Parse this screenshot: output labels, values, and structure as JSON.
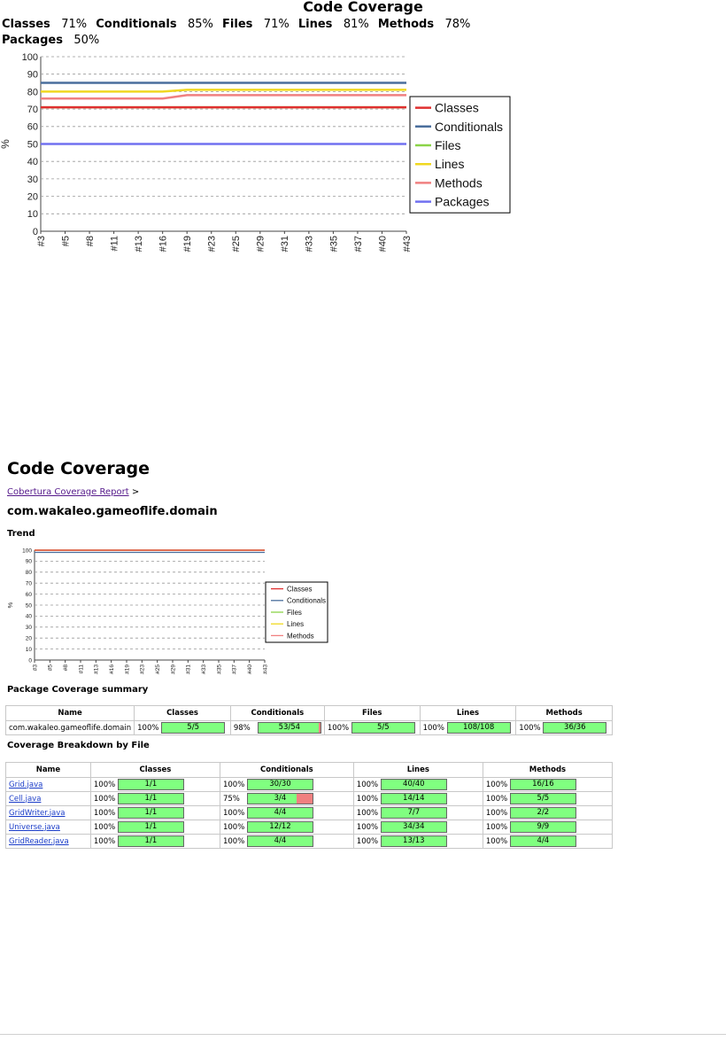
{
  "top": {
    "title": "Code Coverage",
    "summary_row1": [
      {
        "k": "Classes",
        "v": "71%"
      },
      {
        "k": "Conditionals",
        "v": "85%"
      },
      {
        "k": "Files",
        "v": "71%"
      },
      {
        "k": "Lines",
        "v": "81%"
      },
      {
        "k": "Methods",
        "v": "78%"
      }
    ],
    "summary_row2": [
      {
        "k": "Packages",
        "v": "50%"
      }
    ]
  },
  "section": {
    "heading": "Code Coverage",
    "breadcrumb_link": "Cobertura Coverage Report",
    "breadcrumb_sep": ">",
    "package_title": "com.wakaleo.gameoflife.domain",
    "trend_heading": "Trend",
    "package_summary_heading": "Package Coverage summary",
    "breakdown_heading": "Coverage Breakdown by File"
  },
  "chart_data": [
    {
      "type": "line",
      "ylabel": "%",
      "ylim": [
        0,
        100
      ],
      "yticks": [
        0,
        10,
        20,
        30,
        40,
        50,
        60,
        70,
        80,
        90,
        100
      ],
      "categories": [
        "#3",
        "#5",
        "#8",
        "#11",
        "#13",
        "#16",
        "#19",
        "#23",
        "#25",
        "#29",
        "#31",
        "#33",
        "#35",
        "#37",
        "#40",
        "#43"
      ],
      "grid": true,
      "legend_position": "right",
      "series": [
        {
          "name": "Classes",
          "color": "#e03030",
          "values": [
            71,
            71,
            71,
            71,
            71,
            71,
            71,
            71,
            71,
            71,
            71,
            71,
            71,
            71,
            71,
            71
          ]
        },
        {
          "name": "Conditionals",
          "color": "#4a6e9c",
          "values": [
            85,
            85,
            85,
            85,
            85,
            85,
            85,
            85,
            85,
            85,
            85,
            85,
            85,
            85,
            85,
            85
          ]
        },
        {
          "name": "Files",
          "color": "#8bd448",
          "values": [
            71,
            71,
            71,
            71,
            71,
            71,
            71,
            71,
            71,
            71,
            71,
            71,
            71,
            71,
            71,
            71
          ]
        },
        {
          "name": "Lines",
          "color": "#f0d820",
          "values": [
            80,
            80,
            80,
            80,
            80,
            80,
            81,
            81,
            81,
            81,
            81,
            81,
            81,
            81,
            81,
            81
          ]
        },
        {
          "name": "Methods",
          "color": "#f08080",
          "values": [
            76,
            76,
            76,
            76,
            76,
            76,
            78,
            78,
            78,
            78,
            78,
            78,
            78,
            78,
            78,
            78
          ]
        },
        {
          "name": "Packages",
          "color": "#7070f0",
          "values": [
            50,
            50,
            50,
            50,
            50,
            50,
            50,
            50,
            50,
            50,
            50,
            50,
            50,
            50,
            50,
            50
          ]
        }
      ]
    },
    {
      "type": "line",
      "ylabel": "%",
      "ylim": [
        0,
        100
      ],
      "yticks": [
        0,
        10,
        20,
        30,
        40,
        50,
        60,
        70,
        80,
        90,
        100
      ],
      "categories": [
        "#3",
        "#5",
        "#8",
        "#11",
        "#13",
        "#16",
        "#19",
        "#23",
        "#25",
        "#29",
        "#31",
        "#33",
        "#35",
        "#37",
        "#40",
        "#43"
      ],
      "grid": true,
      "legend_position": "right",
      "series": [
        {
          "name": "Classes",
          "color": "#e03030",
          "values": [
            100,
            100,
            100,
            100,
            100,
            100,
            100,
            100,
            100,
            100,
            100,
            100,
            100,
            100,
            100,
            100
          ]
        },
        {
          "name": "Conditionals",
          "color": "#4a6e9c",
          "values": [
            98,
            98,
            98,
            98,
            98,
            98,
            98,
            98,
            98,
            98,
            98,
            98,
            98,
            98,
            98,
            98
          ]
        },
        {
          "name": "Files",
          "color": "#8bd448",
          "values": [
            100,
            100,
            100,
            100,
            100,
            100,
            100,
            100,
            100,
            100,
            100,
            100,
            100,
            100,
            100,
            100
          ]
        },
        {
          "name": "Lines",
          "color": "#f0d820",
          "values": [
            100,
            100,
            100,
            100,
            100,
            100,
            100,
            100,
            100,
            100,
            100,
            100,
            100,
            100,
            100,
            100
          ]
        },
        {
          "name": "Methods",
          "color": "#f08080",
          "values": [
            100,
            100,
            100,
            100,
            100,
            100,
            100,
            100,
            100,
            100,
            100,
            100,
            100,
            100,
            100,
            100
          ]
        }
      ]
    }
  ],
  "package_table": {
    "headers": [
      "Name",
      "Classes",
      "Conditionals",
      "Files",
      "Lines",
      "Methods"
    ],
    "rows": [
      {
        "name": "com.wakaleo.gameoflife.domain",
        "cells": [
          {
            "pct": "100%",
            "ratio": "5/5",
            "frac": 1.0
          },
          {
            "pct": "98%",
            "ratio": "53/54",
            "frac": 0.98
          },
          {
            "pct": "100%",
            "ratio": "5/5",
            "frac": 1.0
          },
          {
            "pct": "100%",
            "ratio": "108/108",
            "frac": 1.0
          },
          {
            "pct": "100%",
            "ratio": "36/36",
            "frac": 1.0
          }
        ]
      }
    ]
  },
  "file_table": {
    "headers": [
      "Name",
      "Classes",
      "Conditionals",
      "Lines",
      "Methods"
    ],
    "rows": [
      {
        "name": "Grid.java",
        "cells": [
          {
            "pct": "100%",
            "ratio": "1/1",
            "frac": 1.0
          },
          {
            "pct": "100%",
            "ratio": "30/30",
            "frac": 1.0
          },
          {
            "pct": "100%",
            "ratio": "40/40",
            "frac": 1.0
          },
          {
            "pct": "100%",
            "ratio": "16/16",
            "frac": 1.0
          }
        ]
      },
      {
        "name": "Cell.java",
        "cells": [
          {
            "pct": "100%",
            "ratio": "1/1",
            "frac": 1.0
          },
          {
            "pct": "75%",
            "ratio": "3/4",
            "frac": 0.75
          },
          {
            "pct": "100%",
            "ratio": "14/14",
            "frac": 1.0
          },
          {
            "pct": "100%",
            "ratio": "5/5",
            "frac": 1.0
          }
        ]
      },
      {
        "name": "GridWriter.java",
        "cells": [
          {
            "pct": "100%",
            "ratio": "1/1",
            "frac": 1.0
          },
          {
            "pct": "100%",
            "ratio": "4/4",
            "frac": 1.0
          },
          {
            "pct": "100%",
            "ratio": "7/7",
            "frac": 1.0
          },
          {
            "pct": "100%",
            "ratio": "2/2",
            "frac": 1.0
          }
        ]
      },
      {
        "name": "Universe.java",
        "cells": [
          {
            "pct": "100%",
            "ratio": "1/1",
            "frac": 1.0
          },
          {
            "pct": "100%",
            "ratio": "12/12",
            "frac": 1.0
          },
          {
            "pct": "100%",
            "ratio": "34/34",
            "frac": 1.0
          },
          {
            "pct": "100%",
            "ratio": "9/9",
            "frac": 1.0
          }
        ]
      },
      {
        "name": "GridReader.java",
        "cells": [
          {
            "pct": "100%",
            "ratio": "1/1",
            "frac": 1.0
          },
          {
            "pct": "100%",
            "ratio": "4/4",
            "frac": 1.0
          },
          {
            "pct": "100%",
            "ratio": "13/13",
            "frac": 1.0
          },
          {
            "pct": "100%",
            "ratio": "4/4",
            "frac": 1.0
          }
        ]
      }
    ]
  }
}
